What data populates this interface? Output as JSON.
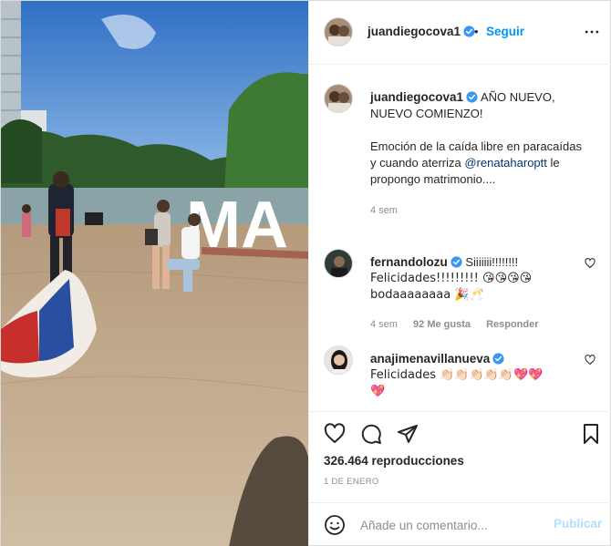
{
  "post": {
    "author": "juandiegocova1",
    "follow_label": "Seguir",
    "separator": "•",
    "caption_lines": [
      "AÑO NUEVO,",
      "NUEVO COMIENZO!"
    ],
    "caption_body_before": "Emoción de la caída libre en paracaídas y cuando aterriza",
    "caption_mention": "@renataharoptt",
    "caption_body_after": "le propongo matrimonio....",
    "caption_time": "4 sem"
  },
  "comments": [
    {
      "user": "fernandolozu",
      "verified": true,
      "lines": [
        "Siiiiiii!!!!!!!!",
        "Felicidades!!!!!!!!! 😘😘😘😘",
        "bodaaaaaaaa 🎉🥂"
      ],
      "time": "4 sem",
      "likes": "92 Me gusta",
      "reply": "Responder"
    },
    {
      "user": "anajimenavillanueva",
      "verified": true,
      "lines": [
        "Felicidades 👏🏻👏🏻👏🏻👏🏻👏🏻💖💖",
        "💖"
      ]
    }
  ],
  "stats": {
    "views": "326.464 reproducciones",
    "date": "1 DE ENERO"
  },
  "composer": {
    "placeholder": "Añade un comentario...",
    "publish_label": "Publicar"
  },
  "media": {
    "sign_text": "MA"
  },
  "colors": {
    "accent": "#0095f6",
    "verified": "#3897f0",
    "mention": "#00376b",
    "muted": "#8e8e8e",
    "publish_disabled": "#b2dffc"
  }
}
